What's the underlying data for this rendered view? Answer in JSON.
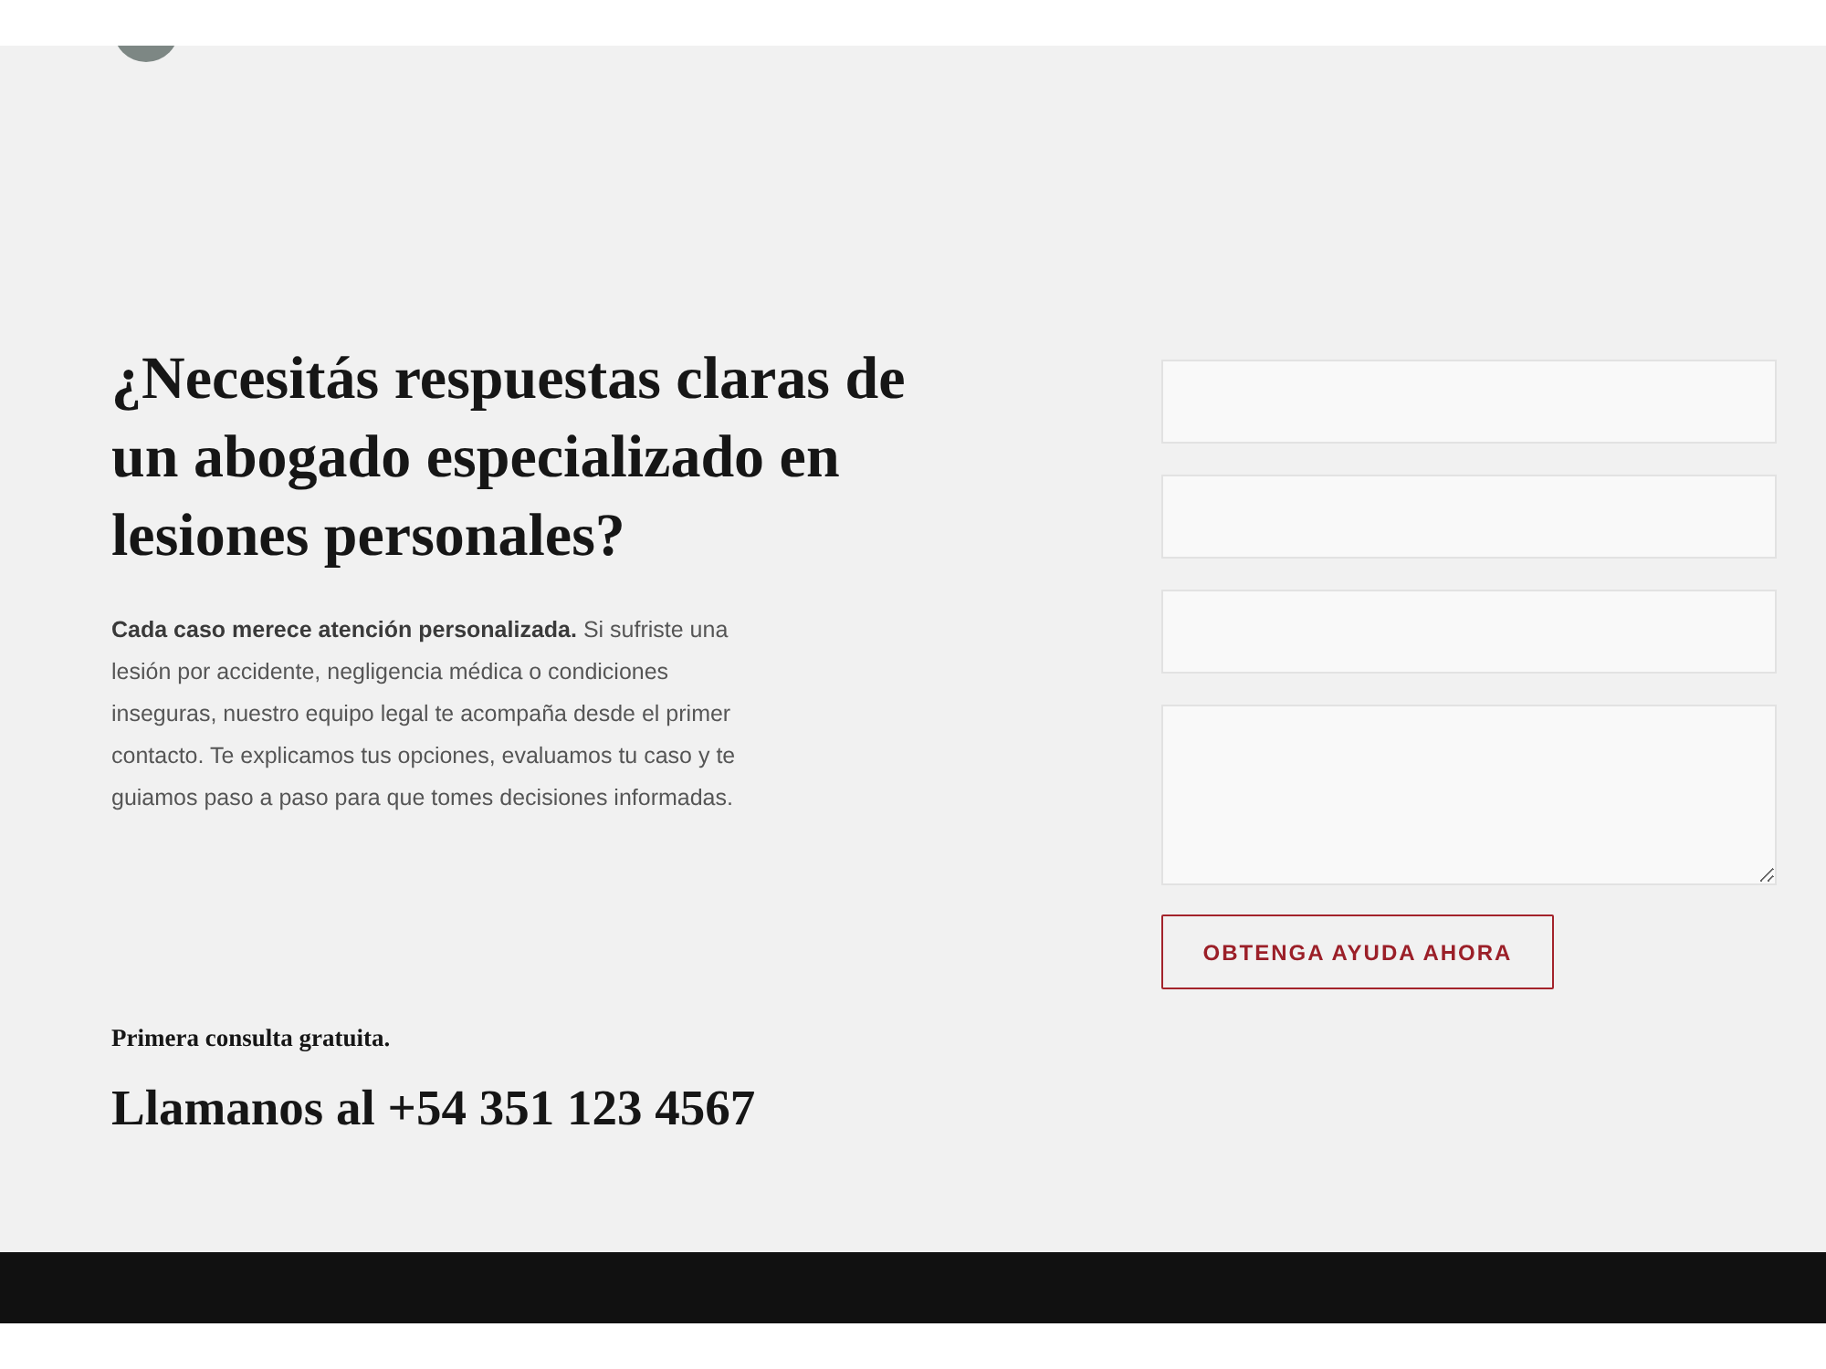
{
  "hero": {
    "heading": "¿Necesitás respuestas claras de un abogado especializado en lesiones personales?",
    "intro": "**Cada caso merece atención personalizada.** Si sufriste una lesión por accidente, negligencia médica o condiciones inseguras, nuestro equipo legal te acompaña desde el primer contacto. Te explicamos tus opciones, evaluamos tu caso y te guiamos paso a paso para que tomes decisiones informadas.",
    "note": "Primera consulta gratuita.",
    "phone_line": "Llamanos al +54 351 123 4567"
  },
  "form": {
    "fields": [
      {
        "kind": "input"
      },
      {
        "kind": "input"
      },
      {
        "kind": "input"
      },
      {
        "kind": "textarea"
      }
    ],
    "submit": "OBTENGA AYUDA AHORA"
  }
}
